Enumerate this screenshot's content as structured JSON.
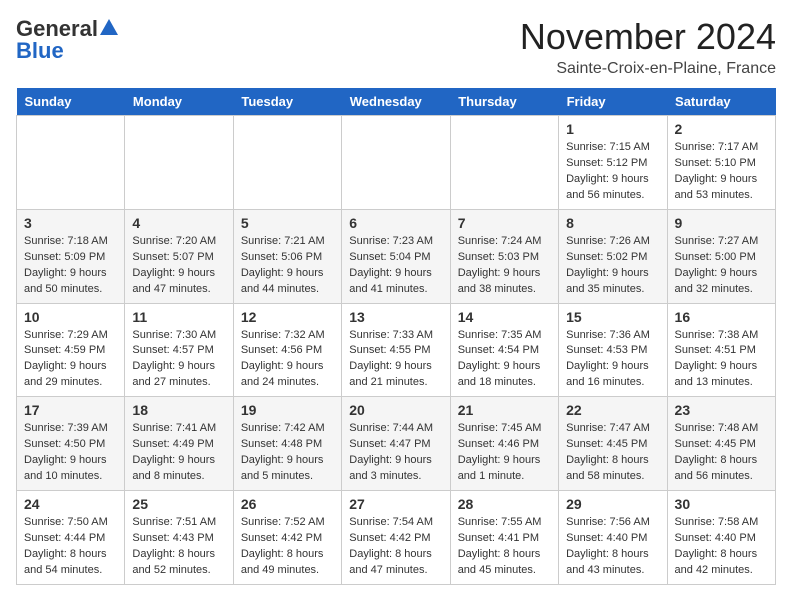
{
  "header": {
    "logo_general": "General",
    "logo_blue": "Blue",
    "month_title": "November 2024",
    "location": "Sainte-Croix-en-Plaine, France"
  },
  "weekdays": [
    "Sunday",
    "Monday",
    "Tuesday",
    "Wednesday",
    "Thursday",
    "Friday",
    "Saturday"
  ],
  "weeks": [
    [
      {
        "day": "",
        "info": ""
      },
      {
        "day": "",
        "info": ""
      },
      {
        "day": "",
        "info": ""
      },
      {
        "day": "",
        "info": ""
      },
      {
        "day": "",
        "info": ""
      },
      {
        "day": "1",
        "info": "Sunrise: 7:15 AM\nSunset: 5:12 PM\nDaylight: 9 hours and 56 minutes."
      },
      {
        "day": "2",
        "info": "Sunrise: 7:17 AM\nSunset: 5:10 PM\nDaylight: 9 hours and 53 minutes."
      }
    ],
    [
      {
        "day": "3",
        "info": "Sunrise: 7:18 AM\nSunset: 5:09 PM\nDaylight: 9 hours and 50 minutes."
      },
      {
        "day": "4",
        "info": "Sunrise: 7:20 AM\nSunset: 5:07 PM\nDaylight: 9 hours and 47 minutes."
      },
      {
        "day": "5",
        "info": "Sunrise: 7:21 AM\nSunset: 5:06 PM\nDaylight: 9 hours and 44 minutes."
      },
      {
        "day": "6",
        "info": "Sunrise: 7:23 AM\nSunset: 5:04 PM\nDaylight: 9 hours and 41 minutes."
      },
      {
        "day": "7",
        "info": "Sunrise: 7:24 AM\nSunset: 5:03 PM\nDaylight: 9 hours and 38 minutes."
      },
      {
        "day": "8",
        "info": "Sunrise: 7:26 AM\nSunset: 5:02 PM\nDaylight: 9 hours and 35 minutes."
      },
      {
        "day": "9",
        "info": "Sunrise: 7:27 AM\nSunset: 5:00 PM\nDaylight: 9 hours and 32 minutes."
      }
    ],
    [
      {
        "day": "10",
        "info": "Sunrise: 7:29 AM\nSunset: 4:59 PM\nDaylight: 9 hours and 29 minutes."
      },
      {
        "day": "11",
        "info": "Sunrise: 7:30 AM\nSunset: 4:57 PM\nDaylight: 9 hours and 27 minutes."
      },
      {
        "day": "12",
        "info": "Sunrise: 7:32 AM\nSunset: 4:56 PM\nDaylight: 9 hours and 24 minutes."
      },
      {
        "day": "13",
        "info": "Sunrise: 7:33 AM\nSunset: 4:55 PM\nDaylight: 9 hours and 21 minutes."
      },
      {
        "day": "14",
        "info": "Sunrise: 7:35 AM\nSunset: 4:54 PM\nDaylight: 9 hours and 18 minutes."
      },
      {
        "day": "15",
        "info": "Sunrise: 7:36 AM\nSunset: 4:53 PM\nDaylight: 9 hours and 16 minutes."
      },
      {
        "day": "16",
        "info": "Sunrise: 7:38 AM\nSunset: 4:51 PM\nDaylight: 9 hours and 13 minutes."
      }
    ],
    [
      {
        "day": "17",
        "info": "Sunrise: 7:39 AM\nSunset: 4:50 PM\nDaylight: 9 hours and 10 minutes."
      },
      {
        "day": "18",
        "info": "Sunrise: 7:41 AM\nSunset: 4:49 PM\nDaylight: 9 hours and 8 minutes."
      },
      {
        "day": "19",
        "info": "Sunrise: 7:42 AM\nSunset: 4:48 PM\nDaylight: 9 hours and 5 minutes."
      },
      {
        "day": "20",
        "info": "Sunrise: 7:44 AM\nSunset: 4:47 PM\nDaylight: 9 hours and 3 minutes."
      },
      {
        "day": "21",
        "info": "Sunrise: 7:45 AM\nSunset: 4:46 PM\nDaylight: 9 hours and 1 minute."
      },
      {
        "day": "22",
        "info": "Sunrise: 7:47 AM\nSunset: 4:45 PM\nDaylight: 8 hours and 58 minutes."
      },
      {
        "day": "23",
        "info": "Sunrise: 7:48 AM\nSunset: 4:45 PM\nDaylight: 8 hours and 56 minutes."
      }
    ],
    [
      {
        "day": "24",
        "info": "Sunrise: 7:50 AM\nSunset: 4:44 PM\nDaylight: 8 hours and 54 minutes."
      },
      {
        "day": "25",
        "info": "Sunrise: 7:51 AM\nSunset: 4:43 PM\nDaylight: 8 hours and 52 minutes."
      },
      {
        "day": "26",
        "info": "Sunrise: 7:52 AM\nSunset: 4:42 PM\nDaylight: 8 hours and 49 minutes."
      },
      {
        "day": "27",
        "info": "Sunrise: 7:54 AM\nSunset: 4:42 PM\nDaylight: 8 hours and 47 minutes."
      },
      {
        "day": "28",
        "info": "Sunrise: 7:55 AM\nSunset: 4:41 PM\nDaylight: 8 hours and 45 minutes."
      },
      {
        "day": "29",
        "info": "Sunrise: 7:56 AM\nSunset: 4:40 PM\nDaylight: 8 hours and 43 minutes."
      },
      {
        "day": "30",
        "info": "Sunrise: 7:58 AM\nSunset: 4:40 PM\nDaylight: 8 hours and 42 minutes."
      }
    ]
  ]
}
